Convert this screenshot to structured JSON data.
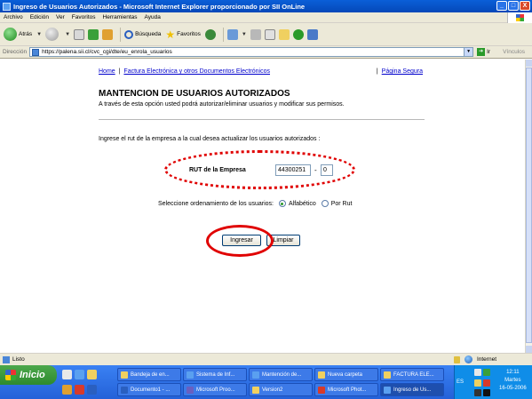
{
  "window": {
    "title": "Ingreso de Usuarios Autorizados - Microsoft Internet Explorer proporcionado por SII OnLine",
    "minimize": "_",
    "maximize": "□",
    "close": "X"
  },
  "menu": [
    "Archivo",
    "Edición",
    "Ver",
    "Favoritos",
    "Herramientas",
    "Ayuda"
  ],
  "toolbar": {
    "back": "Atrás",
    "search": "Búsqueda",
    "favorites": "Favoritos"
  },
  "address": {
    "label": "Dirección",
    "url": "https://palena.sii.cl/cvc_cgi/dte/eu_enrola_usuarios",
    "go": "Ir",
    "links": "Vínculos"
  },
  "page": {
    "nav": {
      "home": "Home",
      "sep": "|",
      "factura": "Factura Electrónica y otros Documentos Electrónicos",
      "secure_sep": "|",
      "secure": "Página Segura"
    },
    "title": "MANTENCION DE USUARIOS AUTORIZADOS",
    "description": "A través de esta opción usted podrá autorizar/eliminar usuarios y modificar sus permisos.",
    "instruction": "Ingrese el rut de la empresa a la cual desea actualizar los usuarios autorizados :",
    "rut_label": "RUT de la Empresa",
    "rut_value": "44300251",
    "rut_dash": "-",
    "dv_value": "0",
    "order_label": "Seleccione ordenamiento de los usuarios:",
    "order_options": [
      {
        "label": "Alfabético",
        "checked": true
      },
      {
        "label": "Por Rut",
        "checked": false
      }
    ],
    "btn_ingresar": "Ingresar",
    "btn_limpiar": "Limpiar"
  },
  "status": {
    "text": "Listo",
    "zone": "Internet"
  },
  "taskbar": {
    "start": "Inicio",
    "tasks_row1": [
      "Bandeja de en...",
      "Sistema de Inf...",
      "Mantención de...",
      "Nueva carpeta",
      "FACTURA ELE..."
    ],
    "tasks_row2": [
      "Documento1 - ...",
      "Microsoft Proo...",
      "Version2",
      "Microsoft Phot...",
      "Ingreso de Us..."
    ],
    "lang": "ES",
    "time": "12:11",
    "day": "Martes",
    "date": "16-05-2006"
  },
  "colors": {
    "annotation_red": "#e00000",
    "link_blue": "#0000cc",
    "xp_blue": "#2461d8"
  }
}
